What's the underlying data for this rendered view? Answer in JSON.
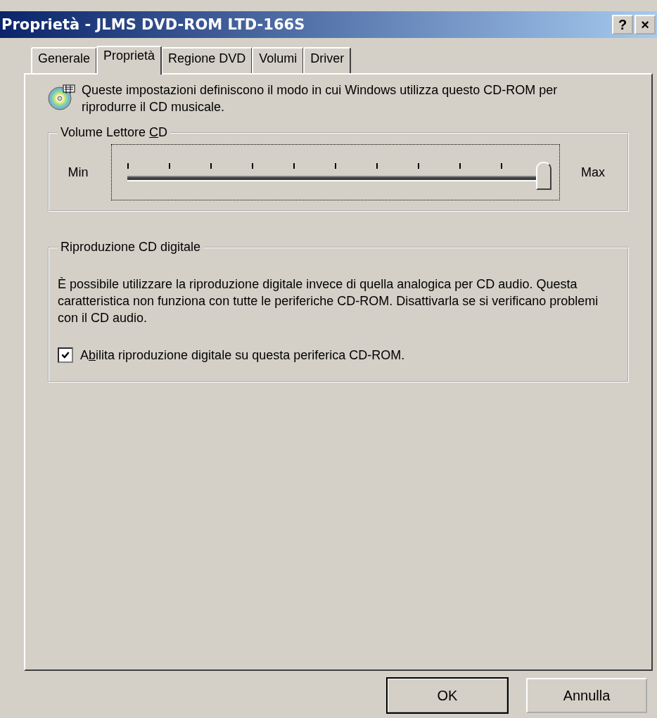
{
  "window": {
    "title": "Proprietà - JLMS DVD-ROM LTD-166S",
    "title_buttons": [
      "?",
      "×"
    ]
  },
  "tabs": [
    {
      "label": "Generale",
      "selected": false
    },
    {
      "label": "Proprietà",
      "selected": true
    },
    {
      "label": "Regione DVD",
      "selected": false
    },
    {
      "label": "Volumi",
      "selected": false
    },
    {
      "label": "Driver",
      "selected": false
    }
  ],
  "intro": "Queste impostazioni definiscono il modo in cui Windows utilizza questo CD-ROM per riprodurre il CD musicale.",
  "volume_group": {
    "label_before": "Volume Lettore ",
    "label_key": "C",
    "label_after": "D",
    "min_label": "Min",
    "max_label": "Max",
    "level": 1.0
  },
  "digital_group": {
    "label": "Riproduzione CD digitale",
    "description": "È possibile utilizzare la riproduzione digitale invece di quella analogica per CD audio. Questa caratteristica non funziona con tutte le periferiche CD-ROM. Disattivarla se si verificano problemi con il CD audio.",
    "checkbox": {
      "label_before": "A",
      "label_key": "b",
      "label_after": "ilita riproduzione digitale su questa periferica CD-ROM.",
      "checked": true
    }
  },
  "buttons": [
    {
      "label": "OK",
      "kind": "default"
    },
    {
      "label": "Annulla",
      "kind": "normal"
    }
  ]
}
